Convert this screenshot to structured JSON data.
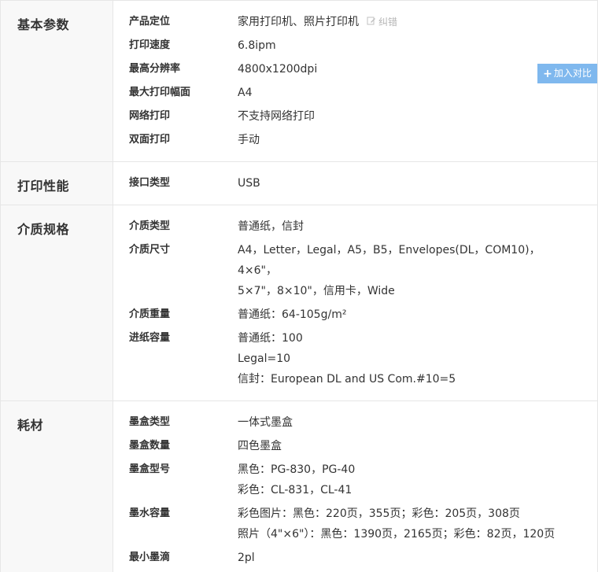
{
  "compare_button": {
    "icon": "plus-icon",
    "label": "加入对比"
  },
  "correct_link": {
    "icon": "edit-icon",
    "label": "纠错"
  },
  "sections": [
    {
      "title": "基本参数",
      "rows": [
        {
          "label": "产品定位",
          "lines": [
            "家用打印机、照片打印机"
          ]
        },
        {
          "label": "打印速度",
          "lines": [
            "6.8ipm"
          ]
        },
        {
          "label": "最高分辨率",
          "lines": [
            "4800x1200dpi"
          ]
        },
        {
          "label": "最大打印幅面",
          "lines": [
            "A4"
          ]
        },
        {
          "label": "网络打印",
          "lines": [
            "不支持网络打印"
          ]
        },
        {
          "label": "双面打印",
          "lines": [
            "手动"
          ]
        }
      ]
    },
    {
      "title": "打印性能",
      "rows": [
        {
          "label": "接口类型",
          "lines": [
            "USB"
          ]
        }
      ]
    },
    {
      "title": "介质规格",
      "rows": [
        {
          "label": "介质类型",
          "lines": [
            "普通纸，信封"
          ]
        },
        {
          "label": "介质尺寸",
          "lines": [
            "A4，Letter，Legal，A5，B5，Envelopes(DL，COM10)，4×6\"，",
            "5×7\"，8×10\"，信用卡，Wide"
          ]
        },
        {
          "label": "介质重量",
          "lines": [
            "普通纸：64-105g/m²"
          ]
        },
        {
          "label": "进纸容量",
          "lines": [
            "普通纸：100",
            "Legal=10",
            "信封：European DL and US Com.#10=5"
          ]
        }
      ]
    },
    {
      "title": "耗材",
      "rows": [
        {
          "label": "墨盒类型",
          "lines": [
            "一体式墨盒"
          ]
        },
        {
          "label": "墨盒数量",
          "lines": [
            "四色墨盒"
          ]
        },
        {
          "label": "墨盒型号",
          "lines": [
            "黑色：PG-830，PG-40",
            "彩色：CL-831，CL-41"
          ]
        },
        {
          "label": "墨水容量",
          "lines": [
            "彩色图片：黑色：220页，355页；彩色：205页，308页",
            "照片（4\"×6\"）：黑色：1390页，2165页；彩色：82页，120页"
          ]
        },
        {
          "label": "最小墨滴",
          "lines": [
            "2pl"
          ]
        }
      ]
    }
  ]
}
